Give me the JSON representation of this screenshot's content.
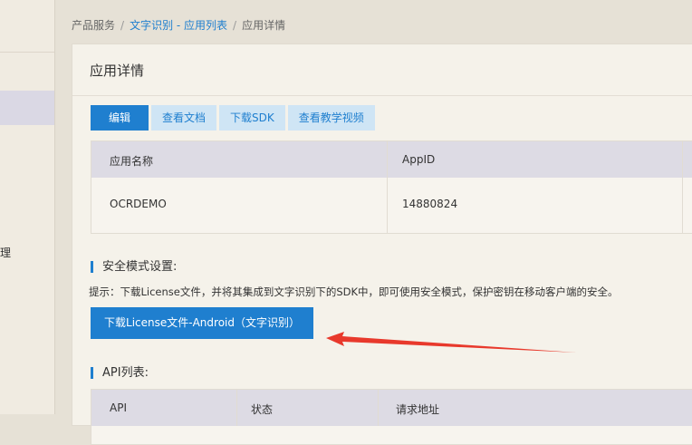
{
  "sidebar": {
    "partial_text": "理"
  },
  "breadcrumb": {
    "items": [
      "产品服务",
      "文字识别 - 应用列表",
      "应用详情"
    ],
    "separator": "/"
  },
  "card": {
    "title": "应用详情"
  },
  "actions": {
    "edit": "编辑",
    "view_docs": "查看文档",
    "download_sdk": "下载SDK",
    "tutorial": "查看教学视频"
  },
  "info_table": {
    "headers": [
      "应用名称",
      "AppID"
    ],
    "row": [
      "OCRDEMO",
      "14880824"
    ]
  },
  "security": {
    "label": "安全模式设置:",
    "tip": "提示：下载License文件，并将其集成到文字识别下的SDK中，即可使用安全模式，保护密钥在移动客户端的安全。",
    "download_button": "下载License文件-Android（文字识别）"
  },
  "api_list": {
    "label": "API列表:",
    "headers": [
      "API",
      "状态",
      "请求地址"
    ]
  },
  "colors": {
    "accent": "#1f7fcf",
    "annotation_arrow": "#e8392c"
  },
  "icons": [
    "arrow-annotation-icon"
  ]
}
